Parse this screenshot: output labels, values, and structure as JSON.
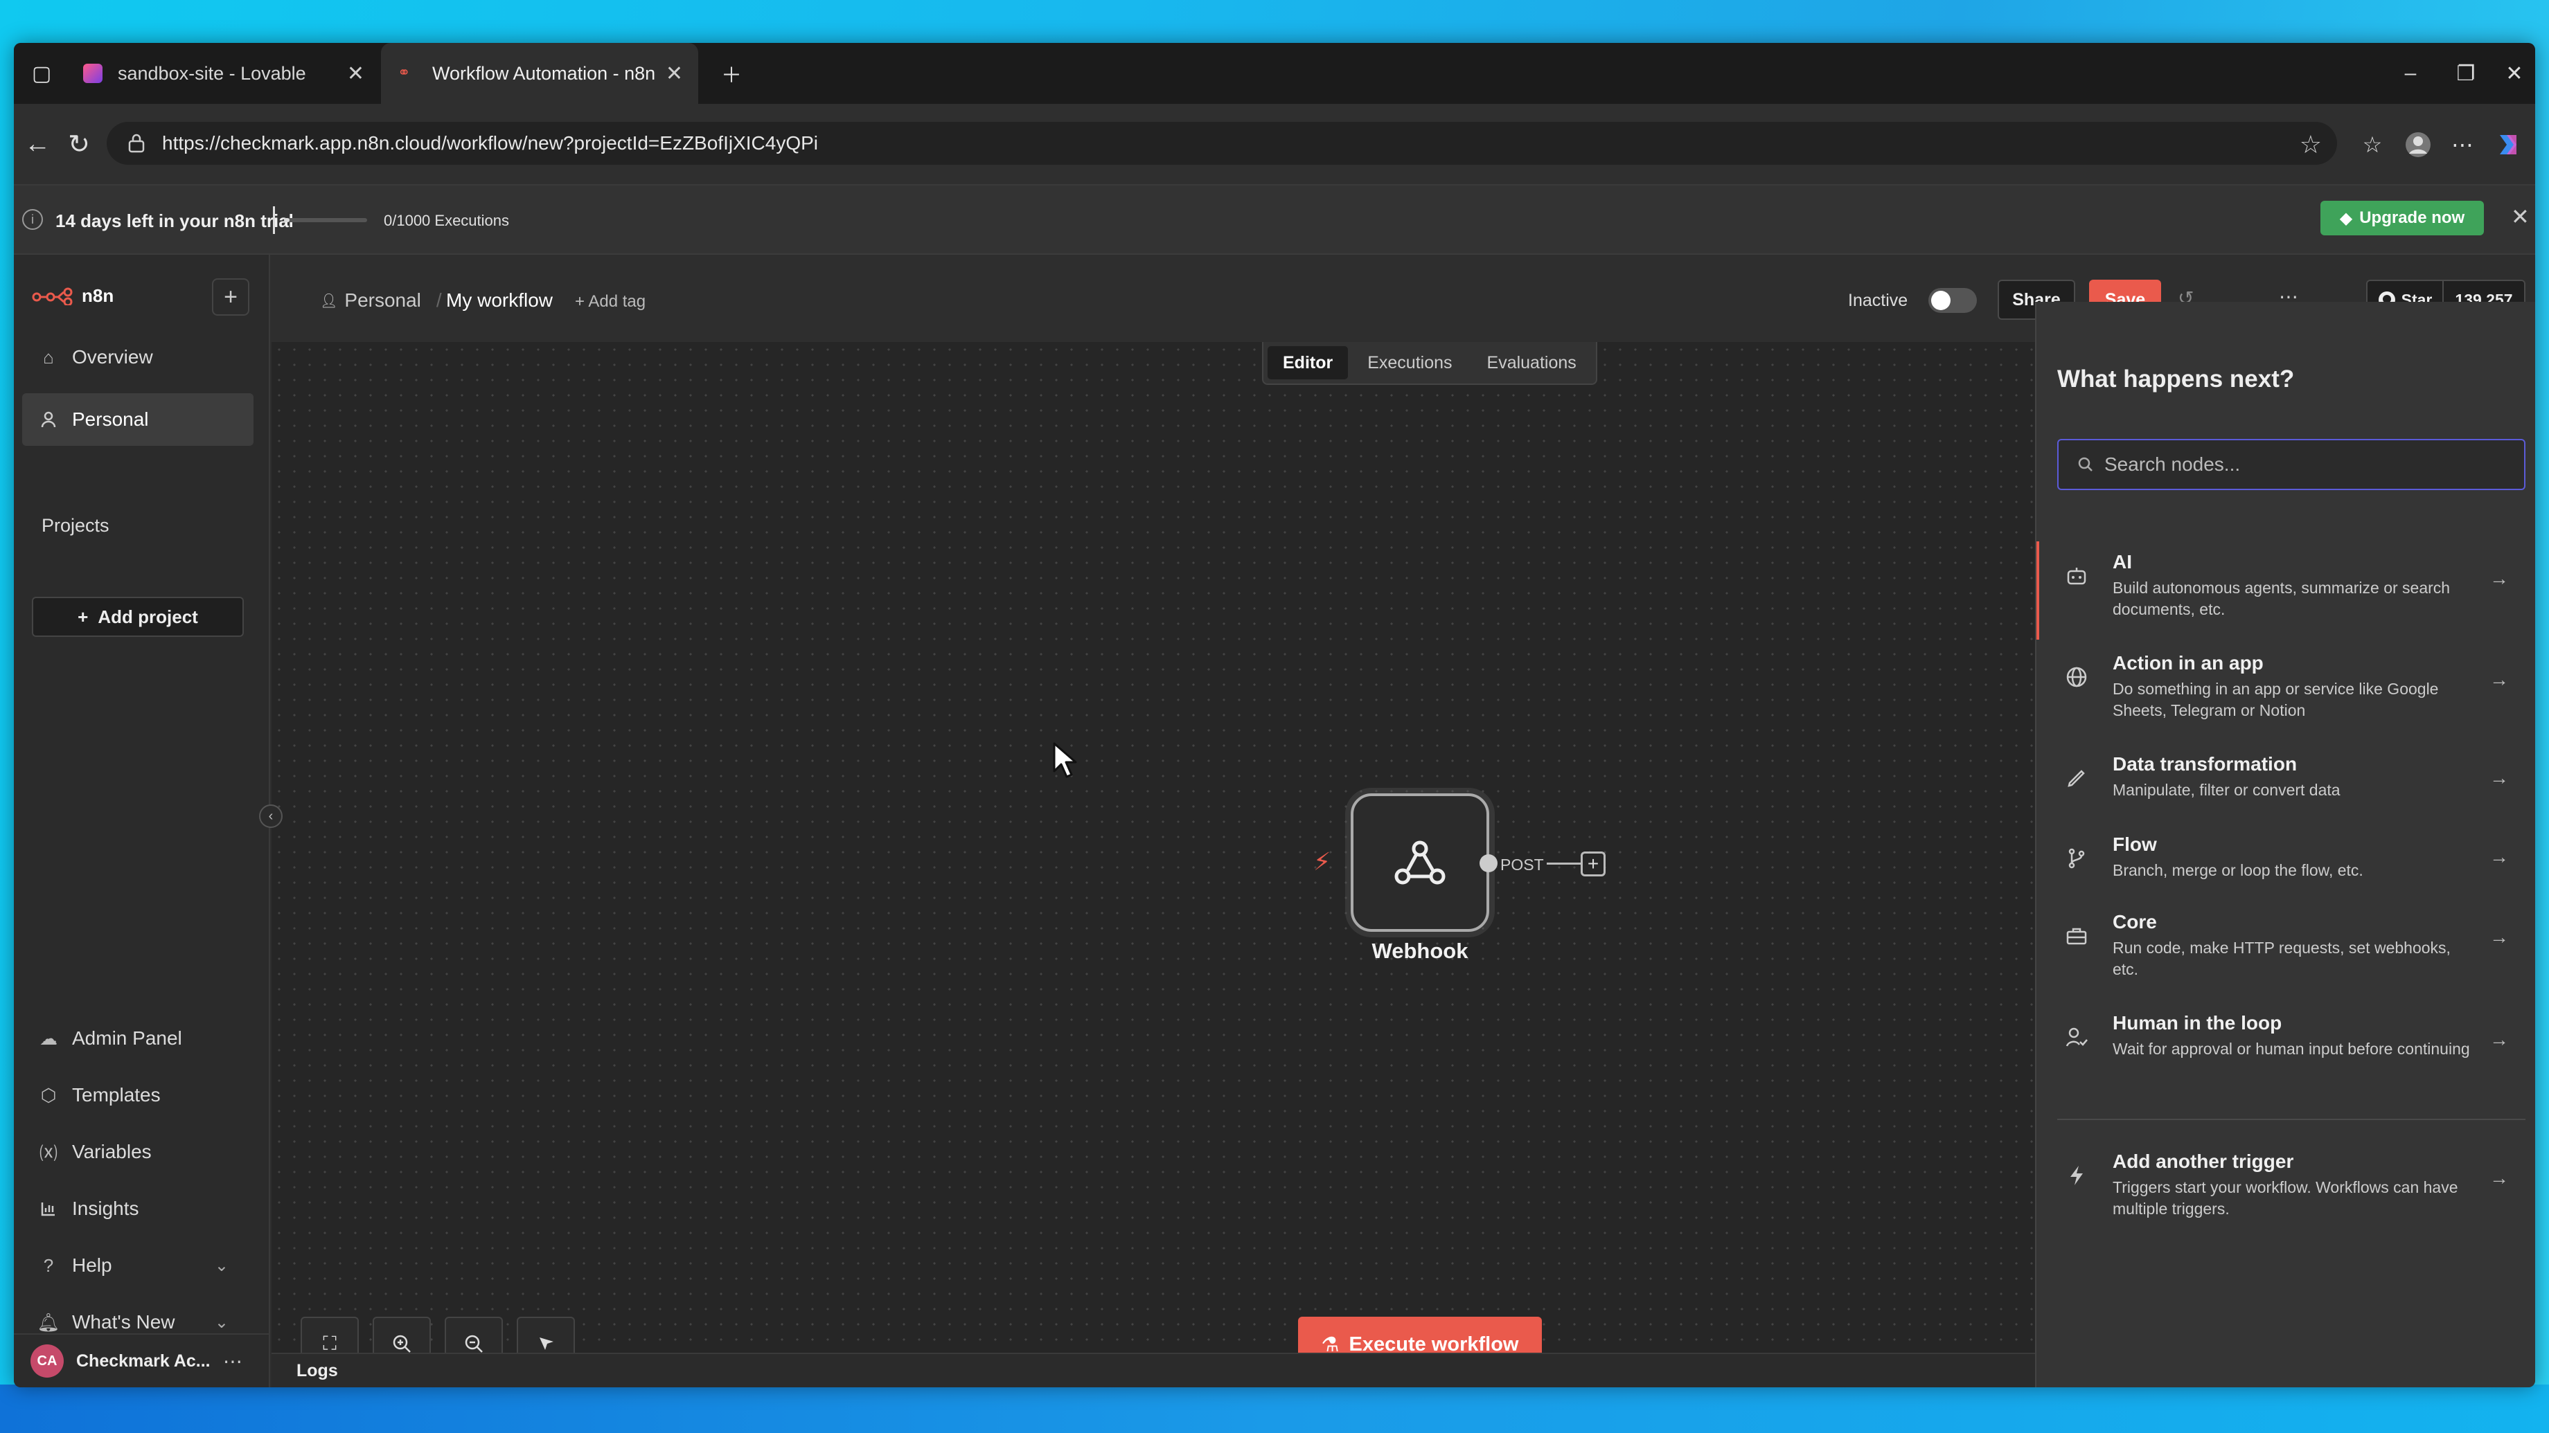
{
  "browser": {
    "tabs": [
      {
        "title": "sandbox-site - Lovable",
        "active": false
      },
      {
        "title": "Workflow Automation - n8n",
        "active": true
      }
    ],
    "url": "https://checkmark.app.n8n.cloud/workflow/new?projectId=EzZBofIjXIC4yQPi"
  },
  "trial": {
    "text": "14 days left in your n8n trial",
    "executions": "0/1000 Executions",
    "executions_progress": 0.0,
    "upgrade_label": "Upgrade now"
  },
  "sidebar": {
    "brand": "n8n",
    "top_items": [
      {
        "label": "Overview",
        "icon": "home-icon"
      },
      {
        "label": "Personal",
        "icon": "user-icon",
        "selected": true
      }
    ],
    "projects_label": "Projects",
    "add_project_label": "Add project",
    "bottom_items": [
      {
        "label": "Admin Panel",
        "icon": "cloud-icon"
      },
      {
        "label": "Templates",
        "icon": "box-icon"
      },
      {
        "label": "Variables",
        "icon": "variable-icon"
      },
      {
        "label": "Insights",
        "icon": "chart-icon"
      },
      {
        "label": "Help",
        "icon": "help-icon"
      },
      {
        "label": "What's New",
        "icon": "bell-icon"
      }
    ],
    "user": {
      "initials": "CA",
      "name": "Checkmark Ac..."
    }
  },
  "header": {
    "breadcrumb_project": "Personal",
    "workflow_name": "My workflow",
    "add_tag": "+ Add tag",
    "status": "Inactive",
    "share_label": "Share",
    "save_label": "Save",
    "github_star": "Star",
    "github_count": "139,257"
  },
  "canvas": {
    "view_tabs": [
      {
        "label": "Editor",
        "active": true
      },
      {
        "label": "Executions",
        "active": false
      },
      {
        "label": "Evaluations",
        "active": false
      }
    ],
    "node": {
      "label": "Webhook",
      "output_label": "POST"
    },
    "execute_label": "Execute workflow",
    "logs_label": "Logs"
  },
  "panel": {
    "title": "What happens next?",
    "search_placeholder": "Search nodes...",
    "items": [
      {
        "title": "AI",
        "desc": "Build autonomous agents, summarize or search documents, etc.",
        "icon": "robot-icon"
      },
      {
        "title": "Action in an app",
        "desc": "Do something in an app or service like Google Sheets, Telegram or Notion",
        "icon": "globe-icon"
      },
      {
        "title": "Data transformation",
        "desc": "Manipulate, filter or convert data",
        "icon": "pen-icon"
      },
      {
        "title": "Flow",
        "desc": "Branch, merge or loop the flow, etc.",
        "icon": "branch-icon"
      },
      {
        "title": "Core",
        "desc": "Run code, make HTTP requests, set webhooks, etc.",
        "icon": "toolbox-icon"
      },
      {
        "title": "Human in the loop",
        "desc": "Wait for approval or human input before continuing",
        "icon": "person-check-icon"
      },
      {
        "title": "Add another trigger",
        "desc": "Triggers start your workflow. Workflows can have multiple triggers.",
        "icon": "bolt-icon"
      }
    ]
  }
}
